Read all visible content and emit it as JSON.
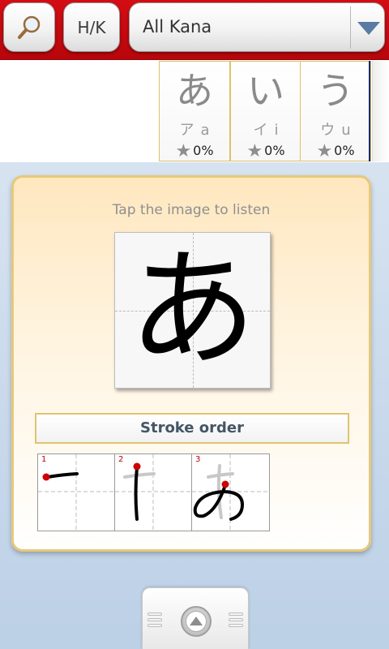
{
  "toolbar": {
    "search_icon": "magnifier-icon",
    "hk_label": "H/K",
    "kana_select": {
      "selected": "All Kana",
      "arrow_icon": "chevron-down-icon"
    }
  },
  "kana_cards": [
    {
      "hiragana": "あ",
      "katakana": "ア",
      "romaji": "a",
      "progress": "0%"
    },
    {
      "hiragana": "い",
      "katakana": "イ",
      "romaji": "i",
      "progress": "0%"
    },
    {
      "hiragana": "う",
      "katakana": "ウ",
      "romaji": "u",
      "progress": "0%"
    }
  ],
  "detail": {
    "hint": "Tap the image to listen",
    "character": "あ",
    "stroke_order_title": "Stroke order",
    "strokes": [
      {
        "number": "1"
      },
      {
        "number": "2"
      },
      {
        "number": "3"
      }
    ]
  },
  "colors": {
    "toolbar_red": "#c80a10",
    "card_border": "#e0c06a",
    "stroke_start": "#cc0000"
  }
}
